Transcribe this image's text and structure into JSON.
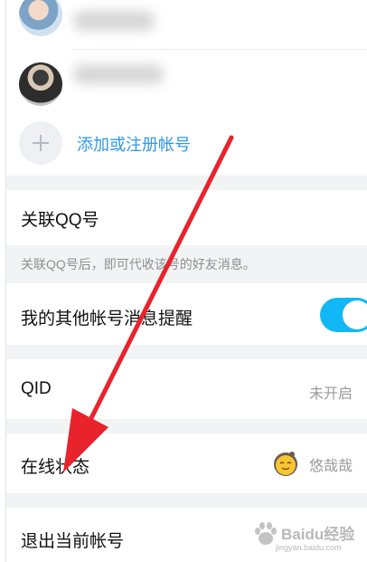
{
  "accounts": [
    {
      "avatar": "account-avatar-1"
    },
    {
      "avatar": "account-avatar-2"
    }
  ],
  "add_account_label": "添加或注册帐号",
  "link_qq": {
    "label": "关联QQ号",
    "hint": "关联QQ号后，即可代收该号的好友消息。"
  },
  "other_account_reminder": {
    "label": "我的其他帐号消息提醒",
    "enabled": true
  },
  "qid": {
    "label": "QID",
    "value": "未开启"
  },
  "online_status": {
    "label": "在线状态",
    "value": "悠哉哉",
    "icon": "smiley-egg-icon"
  },
  "logout_label": "退出当前帐号",
  "watermark": {
    "text": "Baidu经验",
    "url": "jingyan.baidu.com"
  },
  "colors": {
    "accent_blue": "#2f98ea",
    "toggle_on": "#12b7f5",
    "arrow_red": "#e8232b",
    "section_gap": "#f2f3f5"
  }
}
